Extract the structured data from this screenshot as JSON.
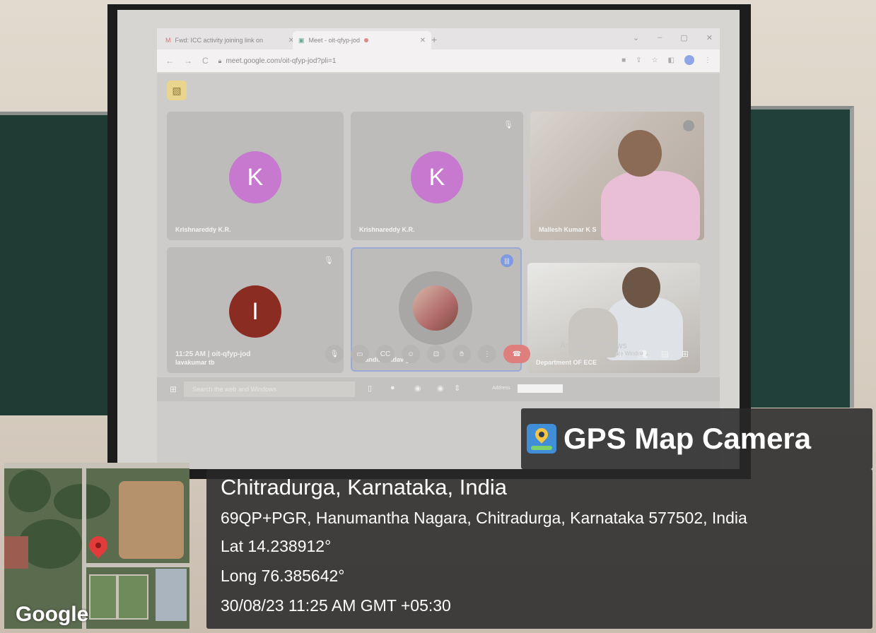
{
  "browser": {
    "tabs": [
      {
        "label": "Fwd: ICC activity joining link on",
        "close": "✕"
      },
      {
        "label": "Meet - oit-qfyp-jod",
        "close": "✕"
      }
    ],
    "new_tab": "+",
    "url": "meet.google.com/oit-qfyp-jod?pli=1"
  },
  "meet": {
    "participants": [
      {
        "name": "Krishnareddy K.R.",
        "initial": "K",
        "avatar_color": "#c679cf",
        "muted": false
      },
      {
        "name": "Krishnareddy K.R.",
        "initial": "K",
        "avatar_color": "#c679cf",
        "muted": true
      },
      {
        "name": "Mallesh Kumar K S",
        "video": true
      },
      {
        "name": "lavakumar tb",
        "initial": "I",
        "avatar_color": "#8a2c22",
        "muted": true
      },
      {
        "name": "Nandini yadav g r",
        "photo": true,
        "speaking": true
      },
      {
        "name": "Department OF ECE",
        "video": true
      }
    ],
    "time_meeting": "11:25 AM  |  oit-qfyp-jod",
    "activate_title": "Activate Windows",
    "activate_sub": "Go to Settings to activate Windows."
  },
  "taskbar": {
    "search_placeholder": "Search the web and Windows",
    "address_label": "Address"
  },
  "gps": {
    "title": "GPS Map Camera",
    "place": "Chitradurga, Karnataka, India",
    "address": "69QP+PGR, Hanumantha Nagara, Chitradurga, Karnataka 577502, India",
    "lat": "Lat 14.238912°",
    "long": "Long 76.385642°",
    "datetime": "30/08/23 11:25 AM GMT +05:30"
  },
  "map": {
    "logo": "Google"
  },
  "colors": {
    "end_call": "#df7f7d",
    "avatar_k": "#c679cf",
    "avatar_i": "#8a2c22",
    "gps_overlay": "rgba(40,40,40,0.86)"
  }
}
